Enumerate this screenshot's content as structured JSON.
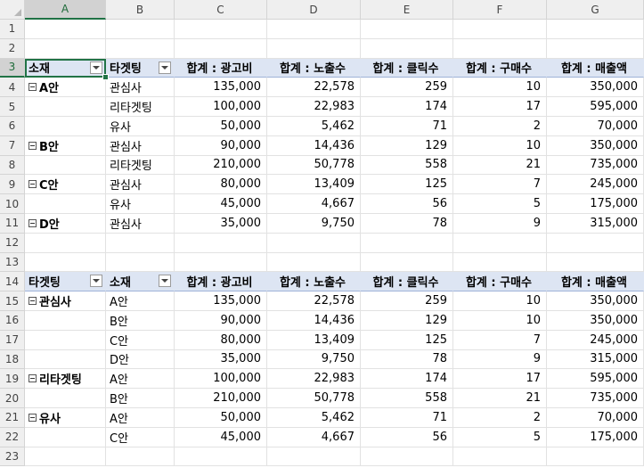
{
  "columns": [
    "A",
    "B",
    "C",
    "D",
    "E",
    "F",
    "G"
  ],
  "selected_column": "A",
  "selected_row": 3,
  "pivot1": {
    "headers": [
      "소재",
      "타겟팅",
      "합계 : 광고비",
      "합계 : 노출수",
      "합계 : 클릭수",
      "합계 : 구매수",
      "합계 : 매출액"
    ],
    "rows": [
      {
        "group": "A안",
        "item": "관심사",
        "v": [
          "135,000",
          "22,578",
          "259",
          "10",
          "350,000"
        ]
      },
      {
        "group": "",
        "item": "리타겟팅",
        "v": [
          "100,000",
          "22,983",
          "174",
          "17",
          "595,000"
        ]
      },
      {
        "group": "",
        "item": "유사",
        "v": [
          "50,000",
          "5,462",
          "71",
          "2",
          "70,000"
        ]
      },
      {
        "group": "B안",
        "item": "관심사",
        "v": [
          "90,000",
          "14,436",
          "129",
          "10",
          "350,000"
        ]
      },
      {
        "group": "",
        "item": "리타겟팅",
        "v": [
          "210,000",
          "50,778",
          "558",
          "21",
          "735,000"
        ]
      },
      {
        "group": "C안",
        "item": "관심사",
        "v": [
          "80,000",
          "13,409",
          "125",
          "7",
          "245,000"
        ]
      },
      {
        "group": "",
        "item": "유사",
        "v": [
          "45,000",
          "4,667",
          "56",
          "5",
          "175,000"
        ]
      },
      {
        "group": "D안",
        "item": "관심사",
        "v": [
          "35,000",
          "9,750",
          "78",
          "9",
          "315,000"
        ]
      }
    ]
  },
  "pivot2": {
    "headers": [
      "타겟팅",
      "소재",
      "합계 : 광고비",
      "합계 : 노출수",
      "합계 : 클릭수",
      "합계 : 구매수",
      "합계 : 매출액"
    ],
    "rows": [
      {
        "group": "관심사",
        "item": "A안",
        "v": [
          "135,000",
          "22,578",
          "259",
          "10",
          "350,000"
        ]
      },
      {
        "group": "",
        "item": "B안",
        "v": [
          "90,000",
          "14,436",
          "129",
          "10",
          "350,000"
        ]
      },
      {
        "group": "",
        "item": "C안",
        "v": [
          "80,000",
          "13,409",
          "125",
          "7",
          "245,000"
        ]
      },
      {
        "group": "",
        "item": "D안",
        "v": [
          "35,000",
          "9,750",
          "78",
          "9",
          "315,000"
        ]
      },
      {
        "group": "리타겟팅",
        "item": "A안",
        "v": [
          "100,000",
          "22,983",
          "174",
          "17",
          "595,000"
        ]
      },
      {
        "group": "",
        "item": "B안",
        "v": [
          "210,000",
          "50,778",
          "558",
          "21",
          "735,000"
        ]
      },
      {
        "group": "유사",
        "item": "A안",
        "v": [
          "50,000",
          "5,462",
          "71",
          "2",
          "70,000"
        ]
      },
      {
        "group": "",
        "item": "C안",
        "v": [
          "45,000",
          "4,667",
          "56",
          "5",
          "175,000"
        ]
      }
    ]
  }
}
